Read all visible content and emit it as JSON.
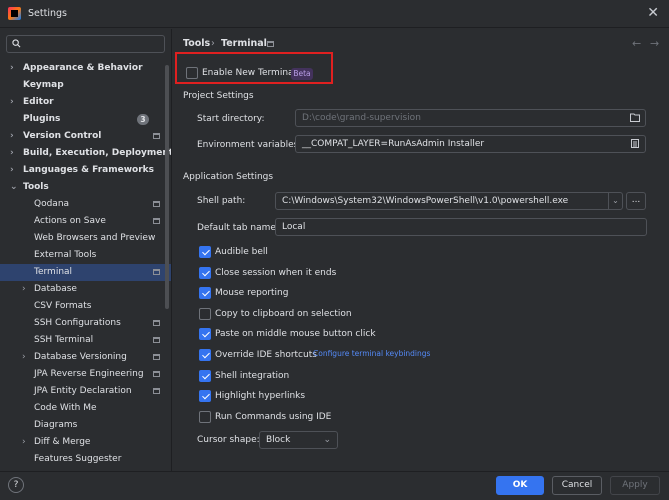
{
  "window": {
    "title": "Settings"
  },
  "sidebar": {
    "search_placeholder": "",
    "items": [
      {
        "label": "Appearance & Behavior",
        "bold": true,
        "expandable": "right"
      },
      {
        "label": "Keymap",
        "bold": true,
        "expandable": "none"
      },
      {
        "label": "Editor",
        "bold": true,
        "expandable": "right"
      },
      {
        "label": "Plugins",
        "bold": true,
        "expandable": "none",
        "badge": "3"
      },
      {
        "label": "Version Control",
        "bold": true,
        "expandable": "right",
        "project_icon": true
      },
      {
        "label": "Build, Execution, Deployment",
        "bold": true,
        "expandable": "right"
      },
      {
        "label": "Languages & Frameworks",
        "bold": true,
        "expandable": "right"
      },
      {
        "label": "Tools",
        "bold": true,
        "expandable": "down"
      },
      {
        "label": "Qodana",
        "child": true,
        "project_icon": true
      },
      {
        "label": "Actions on Save",
        "child": true,
        "project_icon": true
      },
      {
        "label": "Web Browsers and Preview",
        "child": true
      },
      {
        "label": "External Tools",
        "child": true
      },
      {
        "label": "Terminal",
        "child": true,
        "project_icon": true,
        "selected": true
      },
      {
        "label": "Database",
        "child": true,
        "expandable": "right"
      },
      {
        "label": "CSV Formats",
        "child": true
      },
      {
        "label": "SSH Configurations",
        "child": true,
        "project_icon": true
      },
      {
        "label": "SSH Terminal",
        "child": true,
        "project_icon": true
      },
      {
        "label": "Database Versioning",
        "child": true,
        "expandable": "right",
        "project_icon": true
      },
      {
        "label": "JPA Reverse Engineering",
        "child": true,
        "project_icon": true
      },
      {
        "label": "JPA Entity Declaration",
        "child": true,
        "project_icon": true
      },
      {
        "label": "Code With Me",
        "child": true
      },
      {
        "label": "Diagrams",
        "child": true
      },
      {
        "label": "Diff & Merge",
        "child": true,
        "expandable": "right"
      },
      {
        "label": "Features Suggester",
        "child": true
      }
    ]
  },
  "breadcrumb": {
    "parent": "Tools",
    "separator": "›",
    "current": "Terminal"
  },
  "new_terminal": {
    "label": "Enable New Terminal",
    "checked": false,
    "badge": "Beta"
  },
  "project_settings": {
    "heading": "Project Settings",
    "start_directory": {
      "label": "Start directory:",
      "placeholder": "D:\\code\\grand-supervision"
    },
    "env_vars": {
      "label": "Environment variables:",
      "value": "__COMPAT_LAYER=RunAsAdmin Installer"
    }
  },
  "app_settings": {
    "heading": "Application Settings",
    "shell_path": {
      "label": "Shell path:",
      "value": "C:\\Windows\\System32\\WindowsPowerShell\\v1.0\\powershell.exe",
      "browse": "..."
    },
    "tab_name": {
      "label": "Default tab name:",
      "value": "Local"
    },
    "options": [
      {
        "label": "Audible bell",
        "checked": true
      },
      {
        "label": "Close session when it ends",
        "checked": true
      },
      {
        "label": "Mouse reporting",
        "checked": true
      },
      {
        "label": "Copy to clipboard on selection",
        "checked": false
      },
      {
        "label": "Paste on middle mouse button click",
        "checked": true
      },
      {
        "label": "Override IDE shortcuts",
        "checked": true,
        "link": "Configure terminal keybindings"
      },
      {
        "label": "Shell integration",
        "checked": true
      },
      {
        "label": "Highlight hyperlinks",
        "checked": true
      },
      {
        "label": "Run Commands using IDE",
        "checked": false
      }
    ],
    "cursor_shape": {
      "label": "Cursor shape:",
      "value": "Block"
    }
  },
  "footer": {
    "help": "?",
    "ok": "OK",
    "cancel": "Cancel",
    "apply": "Apply"
  },
  "colors": {
    "accent": "#3574f0",
    "selection": "#2e436e",
    "highlight_box": "#e02020",
    "beta_badge": "#43325c"
  }
}
